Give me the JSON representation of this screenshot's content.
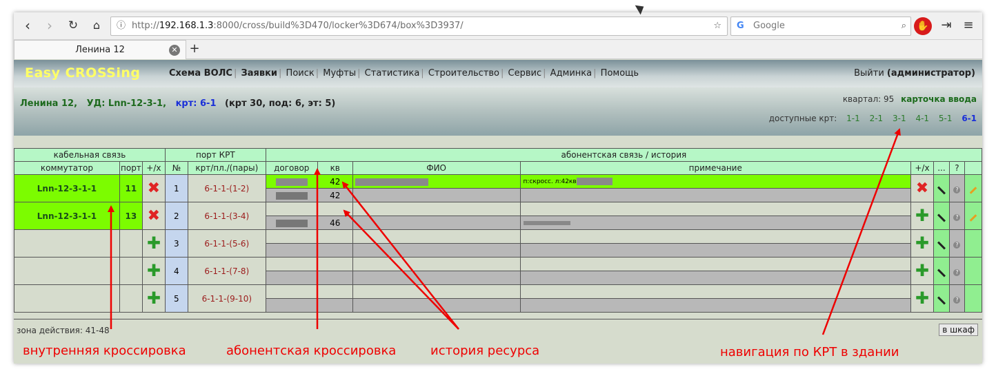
{
  "browser": {
    "url_prefix": "http://",
    "url_host": "192.168.1.3",
    "url_rest": ":8000/cross/build%3D470/locker%3D674/box%3D3937/",
    "search_placeholder": "Google",
    "tab_title": "Ленина 12"
  },
  "app": {
    "logo": "Easy CROSSing",
    "menu": [
      "Схема ВОЛС",
      "Заявки",
      "Поиск",
      "Муфты",
      "Статистика",
      "Строительство",
      "Сервис",
      "Админка",
      "Помощь"
    ],
    "logout": "Выйти",
    "user": "(администратор)"
  },
  "location": {
    "address": "Ленина 12,",
    "ud": "УД: Lnn-12-3-1,",
    "krt": "крт: 6-1",
    "details": "(крт 30, под: 6, эт: 5)",
    "kvartal": "квартал: 95",
    "card": "карточка ввода",
    "avail_label": "доступные крт:",
    "krts": [
      "1-1",
      "2-1",
      "3-1",
      "4-1",
      "5-1",
      "6-1"
    ]
  },
  "table": {
    "groups": [
      "кабельная связь",
      "порт КРТ",
      "абонентская связь / история"
    ],
    "cols": [
      "коммутатор",
      "порт",
      "+/x",
      "№",
      "крт/пл./(пары)",
      "договор",
      "кв",
      "ФИО",
      "примечание",
      "+/x",
      "...",
      "?"
    ],
    "rows": [
      {
        "sw": "Lnn-12-3-1-1",
        "port": "11",
        "n": "1",
        "pair": "6-1-1-(1-2)",
        "kv1": "42",
        "kv2": "42",
        "note1": "п:скросс. л:42кв"
      },
      {
        "sw": "Lnn-12-3-1-1",
        "port": "13",
        "n": "2",
        "pair": "6-1-1-(3-4)",
        "kv1": "",
        "kv2": "46",
        "note1": ""
      },
      {
        "sw": "",
        "port": "",
        "n": "3",
        "pair": "6-1-1-(5-6)",
        "kv1": "",
        "kv2": "",
        "note1": ""
      },
      {
        "sw": "",
        "port": "",
        "n": "4",
        "pair": "6-1-1-(7-8)",
        "kv1": "",
        "kv2": "",
        "note1": ""
      },
      {
        "sw": "",
        "port": "",
        "n": "5",
        "pair": "6-1-1-(9-10)",
        "kv1": "",
        "kv2": "",
        "note1": ""
      }
    ]
  },
  "footer": {
    "zone": "зона действия: 41-48",
    "shkaf": "в шкаф"
  },
  "annotations": {
    "a1": "внутренняя кроссировка",
    "a2": "абонентская кроссировка",
    "a3": "история ресурса",
    "a4": "навигация по КРТ в здании"
  },
  "colors": {
    "green_row": "#7cfc00",
    "header": "#b6f7c6",
    "arrow": "#ee0000"
  }
}
